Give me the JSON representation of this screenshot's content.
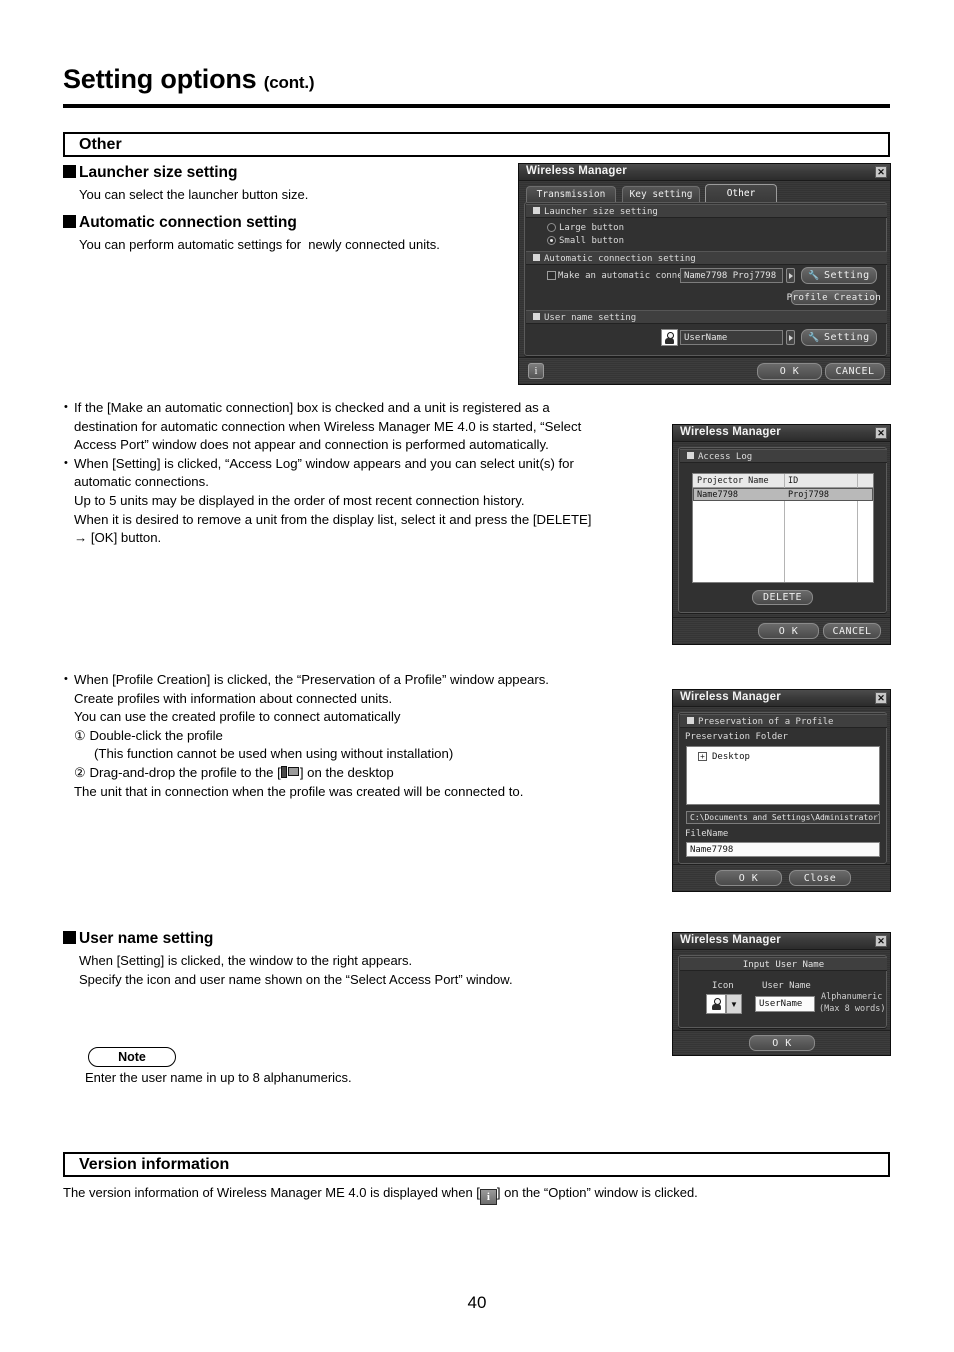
{
  "document": {
    "title": "Setting options",
    "title_suffix": "(cont.)",
    "page_number": "40"
  },
  "sections": {
    "other": {
      "heading": "Other",
      "launcher": {
        "heading": "Launcher size setting",
        "body": "You can select the launcher button size."
      },
      "auto_connection": {
        "heading": "Automatic connection setting",
        "body": "You can perform automatic settings for  newly connected units."
      },
      "user_name": {
        "heading": "User name setting",
        "line1": "When [Setting] is clicked, the window to the right appears.",
        "line2": "Specify the icon and user name shown on the “Select Access Port” window."
      },
      "note": {
        "label": "Note",
        "body": "Enter the user name in up to 8 alphanumerics."
      }
    },
    "version": {
      "heading": "Version information",
      "text_before": "The version information of Wireless Manager ME 4.0 is displayed when [",
      "icon": "info-icon",
      "icon_glyph": "i",
      "text_after": "] on the “Option” window is clicked."
    }
  },
  "bullets": {
    "auto_connection": [
      "If the [Make an automatic connection] box is checked and a unit is registered as a",
      "destination for automatic connection when Wireless Manager ME 4.0 is started,  “Select",
      "Access Port” window does not appear and connection is performed automatically.",
      "When [Setting] is clicked, “Access Log” window appears and you can select unit(s) for",
      "automatic connections.",
      "Up to 5 units may be displayed in the order of most recent connection history.",
      "When it is desired to remove a unit from the display list, select it and press the [DELETE]",
      "→ [OK] button."
    ],
    "profile": {
      "l1": "When [Profile Creation] is clicked, the “Preservation of a Profile” window appears.",
      "l2": "Create profiles with information about connected units.",
      "l3": "You can use the created profile to connect automatically",
      "l4": "① Double-click the profile",
      "l5": "(This function cannot be used when using without installation)",
      "l6_before": "② Drag-and-drop the profile to the [",
      "l6_after": "] on the desktop",
      "l7": "The unit that in connection when the profile was created will be connected to."
    }
  },
  "dialogs": {
    "options": {
      "title": "Wireless Manager",
      "close": "✕",
      "tabs": [
        {
          "label": "Transmission",
          "active": false
        },
        {
          "label": "Key setting",
          "active": false
        },
        {
          "label": "Other",
          "active": true
        }
      ],
      "launcher_group": "Launcher size setting",
      "radio_large": "Large button",
      "radio_small": "Small button",
      "radio_selected": "Small button",
      "auto_group": "Automatic connection setting",
      "auto_checkbox_label": "Make an automatic connection",
      "auto_value": "Name7798 Proj7798",
      "setting_button": "Setting",
      "profile_button": "Profile Creation",
      "user_group": "User name setting",
      "user_value": "UserName",
      "user_setting_button": "Setting",
      "info_button": "i",
      "ok_button": "O K",
      "cancel_button": "CANCEL"
    },
    "access_log": {
      "title": "Wireless Manager",
      "close": "✕",
      "group": "Access Log",
      "columns": [
        "Projector Name",
        "ID"
      ],
      "rows": [
        {
          "name": "Name7798",
          "id": "Proj7798",
          "selected": true
        }
      ],
      "delete_button": "DELETE",
      "ok_button": "O K",
      "cancel_button": "CANCEL"
    },
    "profile": {
      "title": "Wireless Manager",
      "close": "✕",
      "group": "Preservation of a Profile",
      "folder_label": "Preservation Folder",
      "tree_item": "Desktop",
      "tree_expand": "+",
      "path_value": "C:\\Documents and Settings\\Administrator\\Desktop",
      "filename_label": "FileName",
      "filename_value": "Name7798",
      "ok_button": "O K",
      "close_button": "Close"
    },
    "input_user_name": {
      "title": "Wireless Manager",
      "close": "✕",
      "group": "Input User Name",
      "icon_label": "Icon",
      "user_label": "User Name",
      "user_value": "UserName",
      "hint_line1": "Alphanumeric",
      "hint_line2": "(Max 8 words)",
      "combo_arrow": "▼",
      "ok_button": "O K"
    }
  }
}
